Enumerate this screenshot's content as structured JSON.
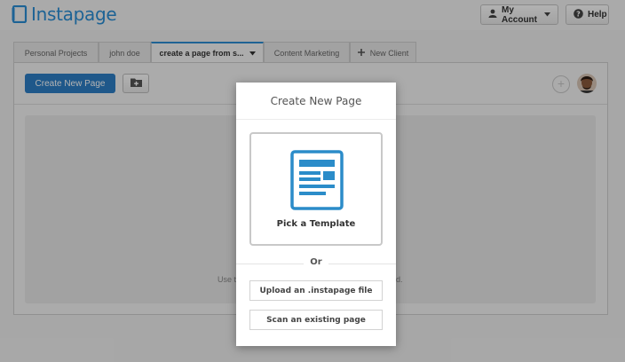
{
  "header": {
    "brand": "Instapage",
    "account_label": "My Account",
    "help_label": "Help"
  },
  "tabs": [
    {
      "label": "Personal Projects"
    },
    {
      "label": "john doe"
    },
    {
      "label": "create a page from s...",
      "active": true
    },
    {
      "label": "Content Marketing"
    },
    {
      "label": "New Client"
    }
  ],
  "toolbar": {
    "create_label": "Create New Page"
  },
  "empty_state": {
    "left_fragment": "Use t",
    "right_fragment": "d."
  },
  "modal": {
    "title": "Create New Page",
    "template_label": "Pick a Template",
    "or_label": "Or",
    "upload_label": "Upload an .instapage file",
    "scan_label": "Scan an existing page"
  },
  "colors": {
    "brand_blue": "#2a8fd6",
    "button_blue": "#2d7fc6",
    "template_icon": "#2b8cc9"
  },
  "icons": {
    "account": "user-icon",
    "help": "question-circle-icon",
    "folder": "folder-plus-icon",
    "template": "document-template-icon"
  }
}
